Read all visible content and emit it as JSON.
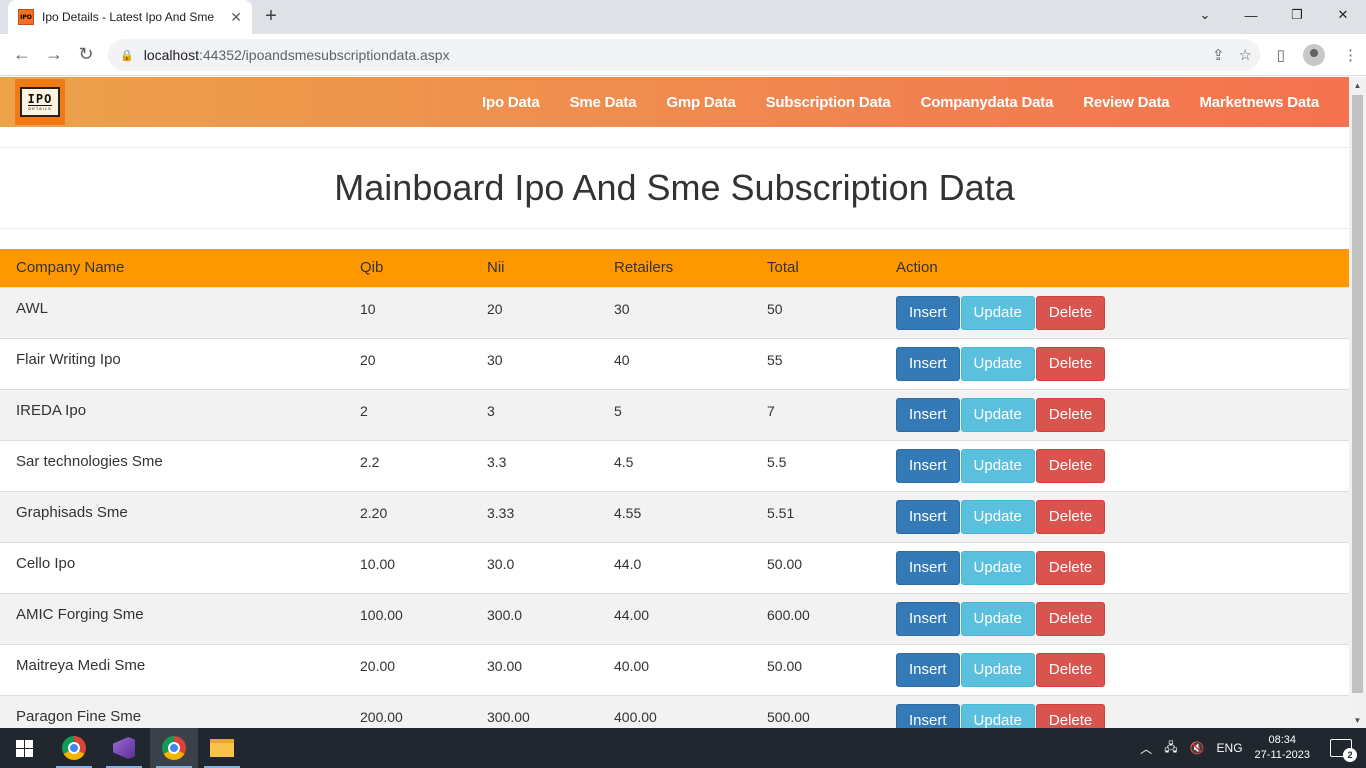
{
  "browser": {
    "tab_title": "Ipo Details - Latest Ipo And Sme",
    "url_host": "localhost",
    "url_rest": ":44352/ipoandsmesubscriptiondata.aspx"
  },
  "site": {
    "logo_main": "IPO",
    "logo_sub": "DETAILS",
    "menu": [
      "Ipo Data",
      "Sme Data",
      "Gmp Data",
      "Subscription Data",
      "Companydata Data",
      "Review Data",
      "Marketnews Data"
    ]
  },
  "page": {
    "title": "Mainboard Ipo And Sme Subscription Data"
  },
  "table": {
    "headers": [
      "Company Name",
      "Qib",
      "Nii",
      "Retailers",
      "Total",
      "Action"
    ],
    "buttons": {
      "insert": "Insert",
      "update": "Update",
      "delete": "Delete"
    },
    "rows": [
      [
        "AWL",
        "10",
        "20",
        "30",
        "50"
      ],
      [
        "Flair Writing Ipo",
        "20",
        "30",
        "40",
        "55"
      ],
      [
        "IREDA Ipo",
        "2",
        "3",
        "5",
        "7"
      ],
      [
        "Sar technologies Sme",
        "2.2",
        "3.3",
        "4.5",
        "5.5"
      ],
      [
        "Graphisads Sme",
        "2.20",
        "3.33",
        "4.55",
        "5.51"
      ],
      [
        "Cello Ipo",
        "10.00",
        "30.0",
        "44.0",
        "50.00"
      ],
      [
        "AMIC Forging Sme",
        "100.00",
        "300.0",
        "44.00",
        "600.00"
      ],
      [
        "Maitreya Medi Sme",
        "20.00",
        "30.00",
        "40.00",
        "50.00"
      ],
      [
        "Paragon Fine Sme",
        "200.00",
        "300.00",
        "400.00",
        "500.00"
      ]
    ]
  },
  "taskbar": {
    "lang": "ENG",
    "time": "08:34",
    "date": "27-11-2023",
    "notifications": "2"
  }
}
